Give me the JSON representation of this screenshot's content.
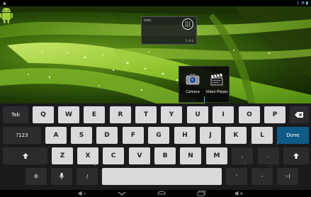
{
  "status_bar": {
    "left_icons": [
      "notification-icon"
    ],
    "right_icons": [
      "bluetooth-icon",
      "wifi-icon",
      "battery-icon"
    ]
  },
  "home": {
    "widget": {
      "label": "icon.",
      "counter": "1 of 6"
    },
    "all_apps_icon": "grid-dots-icon",
    "android_icon": "android-icon"
  },
  "popup": {
    "apps": [
      {
        "label": "Camera",
        "icon": "camera-icon"
      },
      {
        "label": "Video Player",
        "icon": "clapperboard-icon"
      }
    ]
  },
  "keyboard": {
    "row1": {
      "tab": "Tab",
      "letters": [
        "Q",
        "W",
        "E",
        "R",
        "T",
        "Y",
        "U",
        "I",
        "O",
        "P"
      ],
      "backspace_icon": "backspace-icon"
    },
    "row2": {
      "symbols": "?123",
      "letters": [
        "A",
        "S",
        "D",
        "F",
        "G",
        "H",
        "J",
        "K",
        "L"
      ],
      "done": "Done"
    },
    "row3": {
      "shift_icon": "shift-icon",
      "letters": [
        "Z",
        "X",
        "C",
        "V",
        "B",
        "N",
        "M"
      ],
      "punct": [
        {
          "label": ",",
          "hint": "!"
        },
        {
          "label": ".",
          "hint": "?"
        }
      ]
    },
    "row4": {
      "settings_icon": "settings-icon",
      "mic_icon": "microphone-icon",
      "slash": "/",
      "slash_hint": "@",
      "apostrophe": "'",
      "apostrophe_hint": "\"",
      "dash": "-",
      "dash_hint": "_",
      "smiley": ":-)"
    }
  },
  "navbar": {
    "icons": [
      "volume-down-icon",
      "back-icon",
      "home-icon",
      "recent-apps-icon",
      "volume-up-icon"
    ]
  },
  "colors": {
    "accent": "#33b5e5",
    "done_key": "#0f5b88",
    "letter_key": "#d9dadc",
    "func_key": "#2a2c2e",
    "keyboard_bg": "#1a1b1d"
  }
}
